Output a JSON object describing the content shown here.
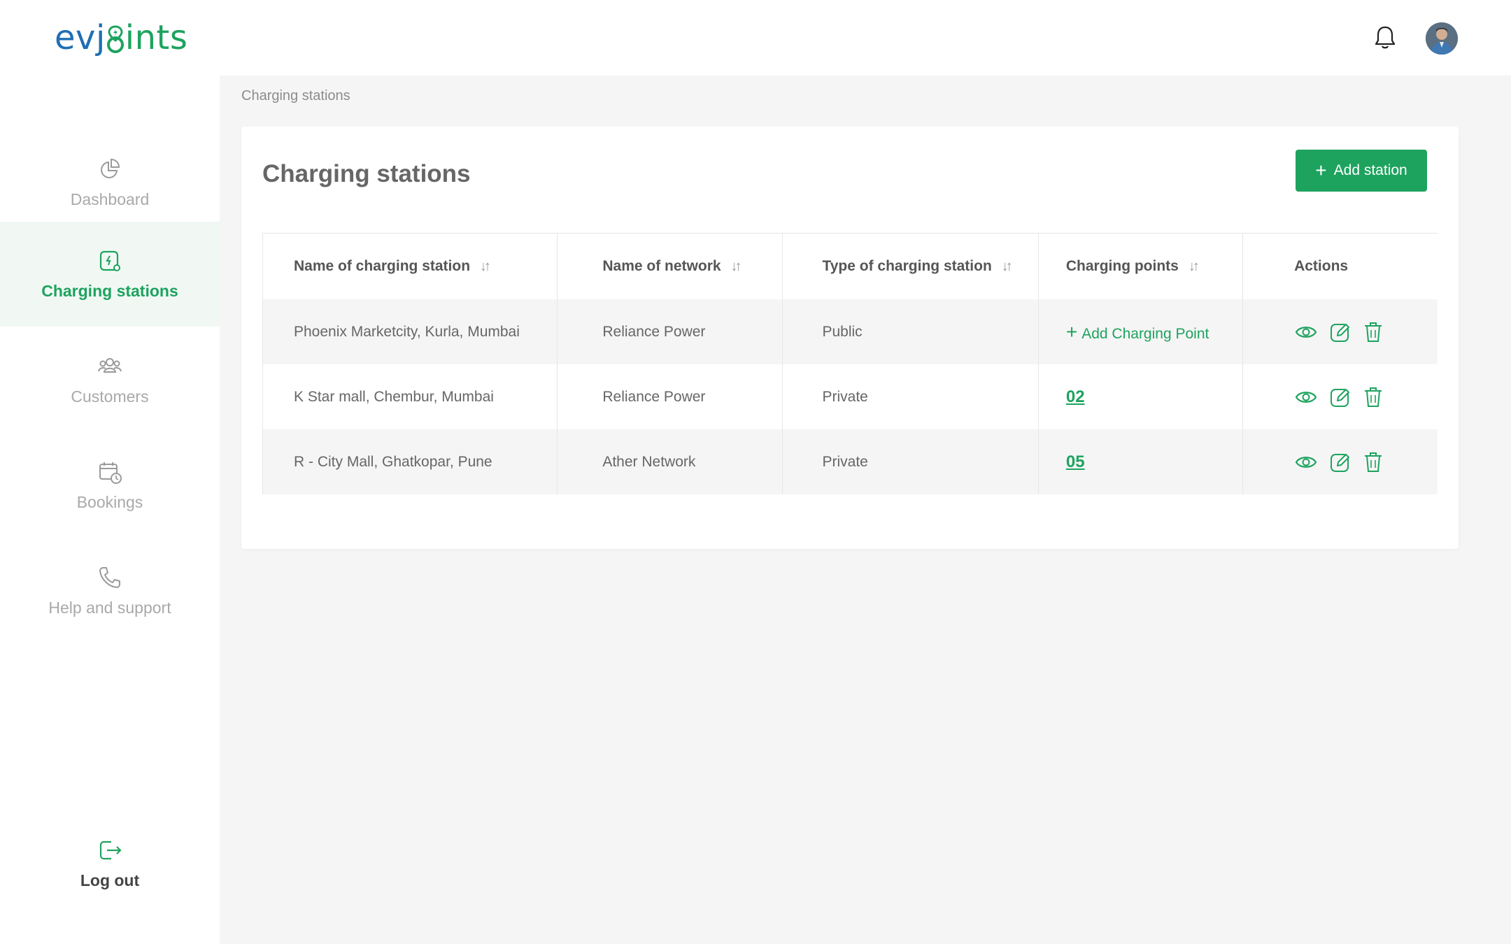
{
  "brand": {
    "logo_prefix": "evj",
    "logo_suffix": "ints",
    "primary_color": "#1ea35f",
    "secondary_color": "#1e6fb3"
  },
  "header": {
    "notification_icon": "bell-icon",
    "avatar_icon": "user-avatar"
  },
  "sidebar": {
    "items": [
      {
        "label": "Dashboard",
        "icon": "pie-chart-icon",
        "active": false
      },
      {
        "label": "Charging stations",
        "icon": "charging-station-icon",
        "active": true
      },
      {
        "label": "Customers",
        "icon": "users-icon",
        "active": false
      },
      {
        "label": "Bookings",
        "icon": "calendar-clock-icon",
        "active": false
      },
      {
        "label": "Help and support",
        "icon": "phone-icon",
        "active": false
      }
    ],
    "logout": {
      "label": "Log out",
      "icon": "logout-icon"
    }
  },
  "breadcrumb": "Charging stations",
  "page": {
    "title": "Charging stations",
    "add_button": {
      "plus": "+",
      "label": "Add station"
    }
  },
  "table": {
    "columns": [
      {
        "label": "Name of charging station",
        "sortable": true
      },
      {
        "label": "Name of network",
        "sortable": true
      },
      {
        "label": "Type of charging station",
        "sortable": true
      },
      {
        "label": "Charging points",
        "sortable": true
      },
      {
        "label": "Actions",
        "sortable": false
      }
    ],
    "sort_glyph": "↓↑",
    "add_point_label": "Add Charging Point",
    "add_point_plus": "+",
    "rows": [
      {
        "station": "Phoenix Marketcity, Kurla, Mumbai",
        "network": "Reliance Power",
        "type": "Public",
        "points": ""
      },
      {
        "station": "K Star mall, Chembur, Mumbai",
        "network": "Reliance Power",
        "type": "Private",
        "points": "02"
      },
      {
        "station": "R - City Mall, Ghatkopar, Pune",
        "network": "Ather Network",
        "type": "Private",
        "points": "05"
      }
    ],
    "action_icons": [
      "eye-icon",
      "edit-icon",
      "trash-icon"
    ]
  }
}
